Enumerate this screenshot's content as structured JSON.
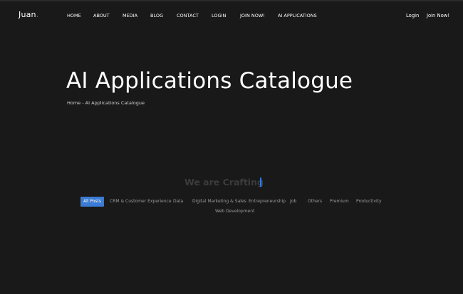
{
  "site": {
    "logo": "Juan",
    "logo_dot": "."
  },
  "nav": {
    "items": [
      "HOME",
      "ABOUT",
      "MEDIA",
      "BLOG",
      "CONTACT",
      "LOGIN",
      "JOIN NOW!",
      "AI APPLICATIONS"
    ],
    "auth": {
      "login": "Login",
      "join": "Join Now!"
    }
  },
  "hero": {
    "title": "AI Applications Catalogue",
    "breadcrumb": "Home - AI Applications Catalogue"
  },
  "section": {
    "typing_text": "We are Crafting"
  },
  "filters": {
    "items": [
      "All Posts",
      "CRM & Customer Experience",
      "Data",
      "Digital Marketing & Sales",
      "Entrepreneurship",
      "Job",
      "Others",
      "Premium",
      "Productivity",
      "Web Development"
    ],
    "active_index": 0,
    "accent_color": "#3a7bd5"
  },
  "colors": {
    "background": "#191919",
    "text": "#ffffff",
    "muted": "#9a9a9a",
    "accent": "#3a7bd5"
  }
}
